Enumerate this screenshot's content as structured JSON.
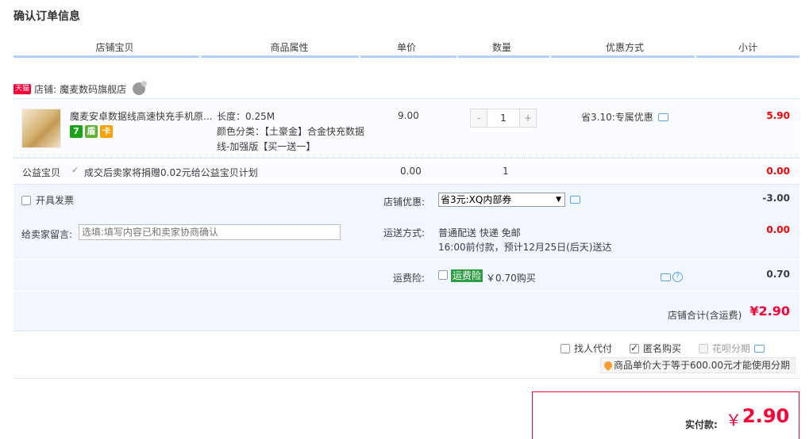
{
  "page_title": "确认订单信息",
  "columns": [
    "店铺宝贝",
    "商品属性",
    "单价",
    "数量",
    "优惠方式",
    "小计"
  ],
  "shop": {
    "badge": "天猫",
    "label": "店铺:",
    "name": "魔麦数码旗舰店",
    "wangwang_count": "1"
  },
  "item": {
    "title": "魔麦安卓数据线高速快充手机原...",
    "sku_length": "长度：0.25M",
    "sku_color": "颜色分类：【土豪金】合金快充数据线-加强版【买一送一】",
    "price": "9.00",
    "quantity": "1",
    "qty_minus": "-",
    "qty_plus": "+",
    "promo": "省3.10:专属优惠",
    "subtotal": "5.90",
    "badges": [
      "7",
      "盾",
      "卡"
    ]
  },
  "charity": {
    "label": "公益宝贝",
    "text": "成交后卖家将捐赠0.02元给公益宝贝计划",
    "price": "0.00",
    "quantity": "1",
    "subtotal": "0.00"
  },
  "options": {
    "invoice_label": "开具发票",
    "shop_discount_label": "店铺优惠:",
    "shop_discount_value": "省3元:XQ内部券",
    "shop_discount_amount": "-3.00",
    "message_label": "给卖家留言:",
    "message_placeholder": "选填:填写内容已和卖家协商确认",
    "shipping_label": "运送方式:",
    "shipping_method": "普通配送 快递 免邮",
    "shipping_eta": "16:00前付款，预计12月25日(后天)送达",
    "shipping_amount": "0.00",
    "insurance_label": "运费险:",
    "insurance_tag": "运费险",
    "insurance_price": "￥0.70购买",
    "insurance_amount": "0.70",
    "shop_total_label": "店铺合计(含运费)",
    "shop_total": "¥2.90"
  },
  "extras": {
    "proxy_pay": "找人代付",
    "anonymous": "匿名购买",
    "huabei": "花呗分期",
    "note": "商品单价大于等于600.00元才能使用分期"
  },
  "payment": {
    "label": "实付款:",
    "currency": "￥",
    "amount": "2.90"
  },
  "colors": {
    "accent_red": "#ff0036",
    "header_line": "#b2d1ff",
    "options_bg": "#f2f7ff"
  }
}
